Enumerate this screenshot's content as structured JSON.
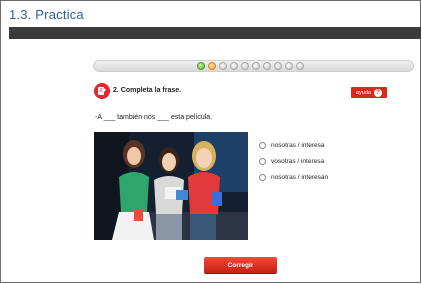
{
  "page_title": "1.3. Practica",
  "progress": {
    "total": 10,
    "completed": 1,
    "current": 2,
    "colors": {
      "done": "#59b02f",
      "current": "#f3a23a",
      "pending": "#bdbdbd"
    }
  },
  "question": {
    "title": "2. Completa la frase.",
    "icon": "pencil-note-icon",
    "help_label": "ayuda",
    "sentence": "-A ___ también nos ___ esta película.",
    "options": [
      "nosotras / interesa",
      "vosotras / interesa",
      "nosotras / interesan"
    ],
    "submit_label": "Corregir"
  },
  "colors": {
    "title_text": "#2f5f9f",
    "accent_red": "#d42a20",
    "top_bar": "#3b3b3b"
  }
}
